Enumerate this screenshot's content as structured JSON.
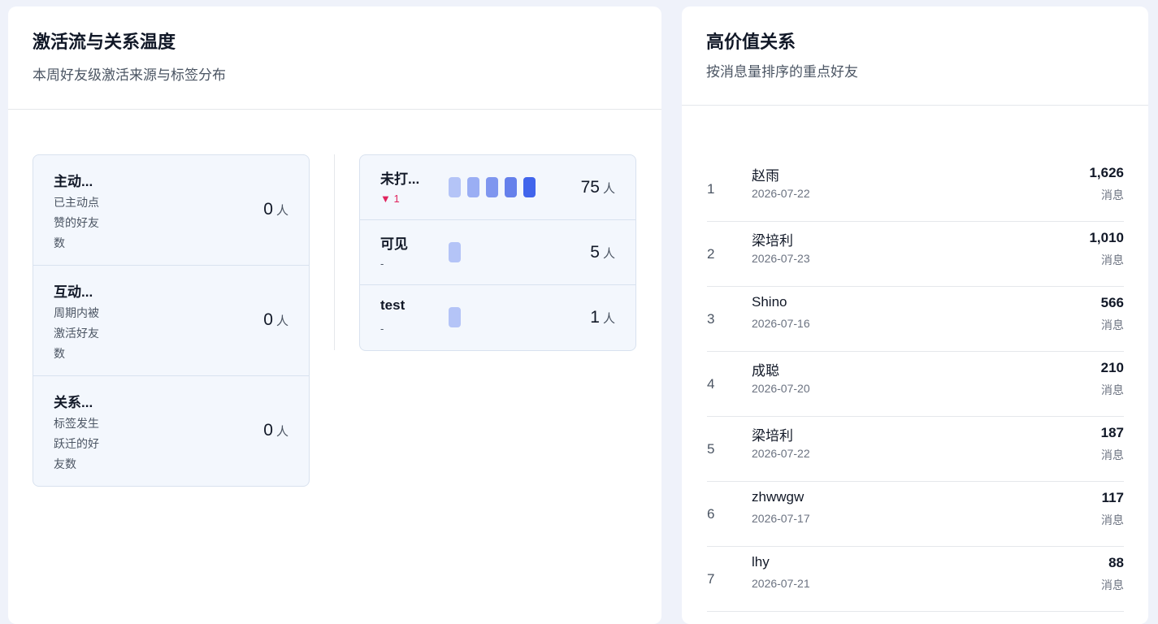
{
  "activation": {
    "title": "激活流与关系温度",
    "subtitle": "本周好友级激活来源与标签分布",
    "metrics": [
      {
        "name": "主动...",
        "desc": "已主动点赞的好友数",
        "value": "0",
        "unit": "人"
      },
      {
        "name": "互动...",
        "desc": "周期内被激活好友数",
        "value": "0",
        "unit": "人"
      },
      {
        "name": "关系...",
        "desc": "标签发生跃迁的好友数",
        "value": "0",
        "unit": "人"
      }
    ],
    "tags": [
      {
        "name": "未打...",
        "delta": "▼ 1",
        "delta_dir": "down",
        "count": "75",
        "unit": "人",
        "level": 5
      },
      {
        "name": "可见",
        "delta": "-",
        "delta_dir": "none",
        "count": "5",
        "unit": "人",
        "level": 1
      },
      {
        "name": "test",
        "delta": "-",
        "delta_dir": "none",
        "count": "1",
        "unit": "人",
        "level": 1
      }
    ],
    "bar_colors": [
      "#b4c4f7",
      "#9aaef4",
      "#7f96ef",
      "#6580eb",
      "#4165ec"
    ]
  },
  "high_value": {
    "title": "高价值关系",
    "subtitle": "按消息量排序的重点好友",
    "rows": [
      {
        "rank": "1",
        "name": "赵雨",
        "date": "2026-07-22",
        "count": "1,626",
        "unit": "消息"
      },
      {
        "rank": "2",
        "name": "梁培利",
        "date": "2026-07-23",
        "count": "1,010",
        "unit": "消息"
      },
      {
        "rank": "3",
        "name": "Shino",
        "date": "2026-07-16",
        "count": "566",
        "unit": "消息"
      },
      {
        "rank": "4",
        "name": "成聪",
        "date": "2026-07-20",
        "count": "210",
        "unit": "消息"
      },
      {
        "rank": "5",
        "name": "梁培利",
        "date": "2026-07-22",
        "count": "187",
        "unit": "消息"
      },
      {
        "rank": "6",
        "name": "zhwwgw",
        "date": "2026-07-17",
        "count": "117",
        "unit": "消息"
      },
      {
        "rank": "7",
        "name": "lhy",
        "date": "2026-07-21",
        "count": "88",
        "unit": "消息"
      }
    ]
  }
}
